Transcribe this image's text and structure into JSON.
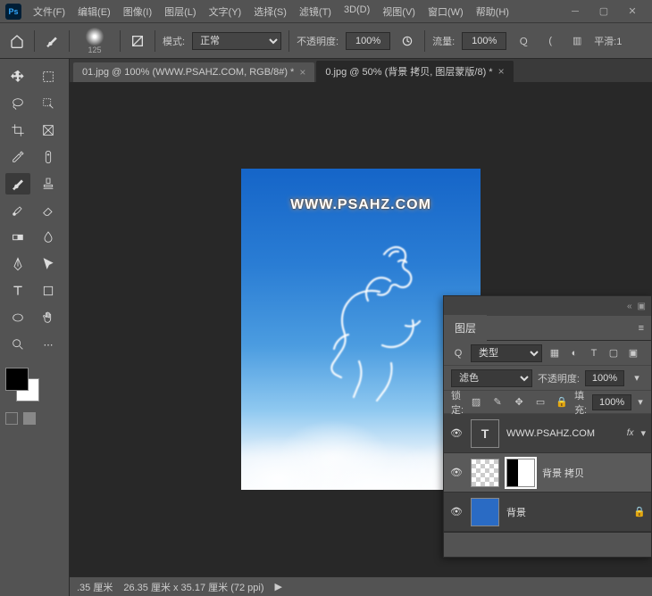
{
  "app": {
    "logo_text": "Ps"
  },
  "menu": {
    "file": "文件(F)",
    "edit": "编辑(E)",
    "image": "图像(I)",
    "layer": "图层(L)",
    "type": "文字(Y)",
    "select": "选择(S)",
    "filter": "滤镜(T)",
    "threed": "3D(D)",
    "view": "视图(V)",
    "window": "窗口(W)",
    "help": "帮助(H)"
  },
  "options": {
    "brush_size": "125",
    "mode_label": "模式:",
    "mode_value": "正常",
    "opacity_label": "不透明度:",
    "opacity_value": "100%",
    "flow_label": "流量:",
    "flow_value": "100%",
    "smooth_label": "平滑:1"
  },
  "tabs": {
    "t1": "01.jpg @ 100% (WWW.PSAHZ.COM, RGB/8#) *",
    "t2": "0.jpg @ 50% (背景 拷贝, 图层蒙版/8) *"
  },
  "canvas": {
    "watermark": "WWW.PSAHZ.COM"
  },
  "status": {
    "zoom": ".35 厘米",
    "dims": "26.35 厘米 x 35.17 厘米 (72 ppi)"
  },
  "layers_panel": {
    "title": "图层",
    "kind_prefix": "Q",
    "kind_value": "类型",
    "blend_value": "滤色",
    "opacity_label": "不透明度:",
    "opacity_value": "100%",
    "lock_label": "锁定:",
    "fill_label": "填充:",
    "fill_value": "100%",
    "layers": {
      "l1_name": "WWW.PSAHZ.COM",
      "l1_fx": "fx",
      "l2_name": "背景 拷贝",
      "l3_name": "背景"
    }
  }
}
